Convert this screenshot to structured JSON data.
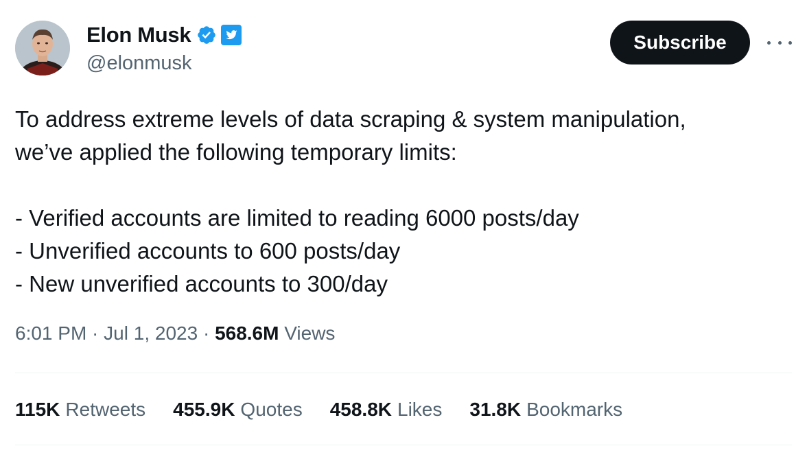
{
  "author": {
    "display_name": "Elon Musk",
    "handle": "@elonmusk",
    "avatar_icon": "avatar",
    "verified_icon": "verified-badge-icon",
    "affiliation_icon": "twitter-logo-icon",
    "verified_color": "#1d9bf0"
  },
  "header": {
    "subscribe_label": "Subscribe",
    "more_icon": "more-horizontal-icon"
  },
  "tweet": {
    "lines": [
      "To address extreme levels of data scraping & system manipulation,",
      "we’ve applied the following temporary limits:",
      "",
      "- Verified accounts are limited to reading 6000 posts/day",
      "- Unverified accounts to 600 posts/day",
      "- New unverified accounts to 300/day"
    ]
  },
  "meta": {
    "time": "6:01 PM",
    "separator": " · ",
    "date": "Jul 1, 2023",
    "views_count": "568.6M",
    "views_label": "Views"
  },
  "stats": [
    {
      "count": "115K",
      "label": "Retweets"
    },
    {
      "count": "455.9K",
      "label": "Quotes"
    },
    {
      "count": "458.8K",
      "label": "Likes"
    },
    {
      "count": "31.8K",
      "label": "Bookmarks"
    }
  ],
  "colors": {
    "text_primary": "#0f1419",
    "text_secondary": "#536471",
    "divider": "#eff3f4",
    "button_bg": "#0f1419"
  }
}
